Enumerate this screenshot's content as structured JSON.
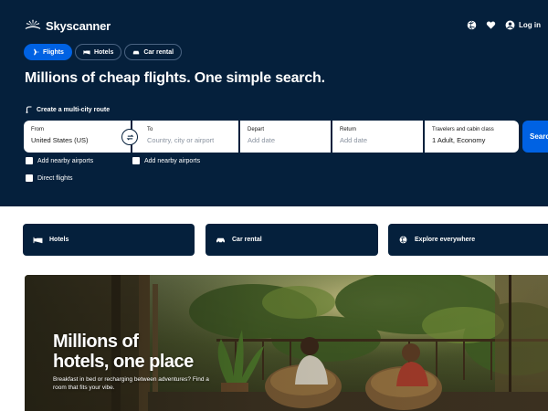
{
  "brand": {
    "name": "Skyscanner"
  },
  "header": {
    "login_label": "Log in",
    "icons": [
      "globe-icon",
      "heart-icon",
      "user-icon"
    ]
  },
  "tabs": [
    {
      "label": "Flights",
      "icon": "plane-icon",
      "active": true
    },
    {
      "label": "Hotels",
      "icon": "bed-icon",
      "active": false
    },
    {
      "label": "Car rental",
      "icon": "car-icon",
      "active": false
    }
  ],
  "hero": {
    "headline": "Millions of cheap flights. One simple search."
  },
  "search": {
    "multicity_label": "Create a multi-city route",
    "from": {
      "label": "From",
      "value": "United States (US)"
    },
    "to": {
      "label": "To",
      "placeholder": "Country, city or airport"
    },
    "depart": {
      "label": "Depart",
      "placeholder": "Add date"
    },
    "return": {
      "label": "Return",
      "placeholder": "Add date"
    },
    "travellers": {
      "label": "Travelers and cabin class",
      "value": "1 Adult, Economy"
    },
    "search_button": "Search",
    "nearby_from_label": "Add nearby airports",
    "nearby_to_label": "Add nearby airports",
    "direct_label": "Direct flights"
  },
  "quick_links": [
    {
      "label": "Hotels",
      "icon": "bed-icon"
    },
    {
      "label": "Car rental",
      "icon": "car-icon"
    },
    {
      "label": "Explore everywhere",
      "icon": "globe-icon"
    }
  ],
  "banner": {
    "title_line1": "Millions of",
    "title_line2": "hotels, one place",
    "subtitle": "Breakfast in bed or recharging between adventures? Find a room that fits your vibe."
  },
  "colors": {
    "navy": "#05203c",
    "accent": "#0062e3"
  }
}
